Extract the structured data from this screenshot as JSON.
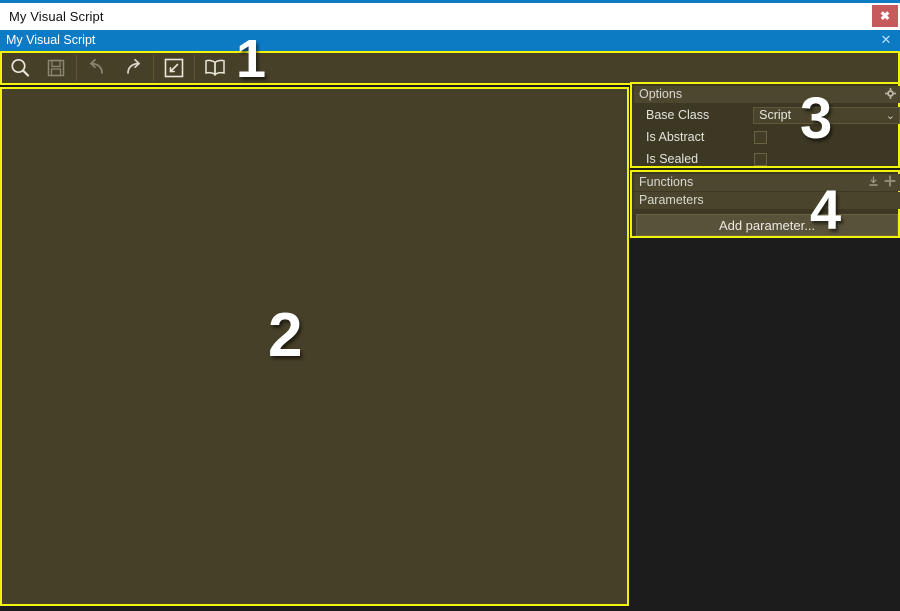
{
  "window": {
    "title": "My Visual Script",
    "close_label": "✖"
  },
  "document_bar": {
    "title": "My Visual Script",
    "close_label": "✕"
  },
  "toolbar": {
    "buttons": [
      {
        "name": "search-icon",
        "tooltip": "Search",
        "enabled": true
      },
      {
        "name": "save-icon",
        "tooltip": "Save",
        "enabled": false
      },
      {
        "name": "undo-icon",
        "tooltip": "Undo",
        "enabled": false
      },
      {
        "name": "redo-icon",
        "tooltip": "Redo",
        "enabled": true
      },
      {
        "name": "fit-to-screen-icon",
        "tooltip": "Fit to screen",
        "enabled": true
      },
      {
        "name": "documentation-icon",
        "tooltip": "Documentation",
        "enabled": true
      }
    ]
  },
  "options": {
    "header": "Options",
    "gear_icon": "gear-icon",
    "rows": [
      {
        "label": "Base Class",
        "control": "dropdown",
        "value": "Script"
      },
      {
        "label": "Is Abstract",
        "control": "checkbox",
        "checked": false
      },
      {
        "label": "Is Sealed",
        "control": "checkbox",
        "checked": false
      }
    ],
    "dropdown_arrow": "⌄"
  },
  "functions": {
    "header": "Functions",
    "header_icons": [
      "import-icon",
      "add-icon"
    ],
    "sub_header": "Parameters",
    "add_parameter_label": "Add parameter..."
  },
  "annotations": {
    "region_1": "1",
    "region_2": "2",
    "region_3": "3",
    "region_4": "4"
  },
  "colors": {
    "accent_blue": "#0d7ac4",
    "highlight_yellow": "#f2f20c",
    "canvas_olive": "#474028",
    "panel_bg": "#3d3823",
    "app_bg": "#1c1c1c",
    "close_red": "#c75b5b"
  }
}
